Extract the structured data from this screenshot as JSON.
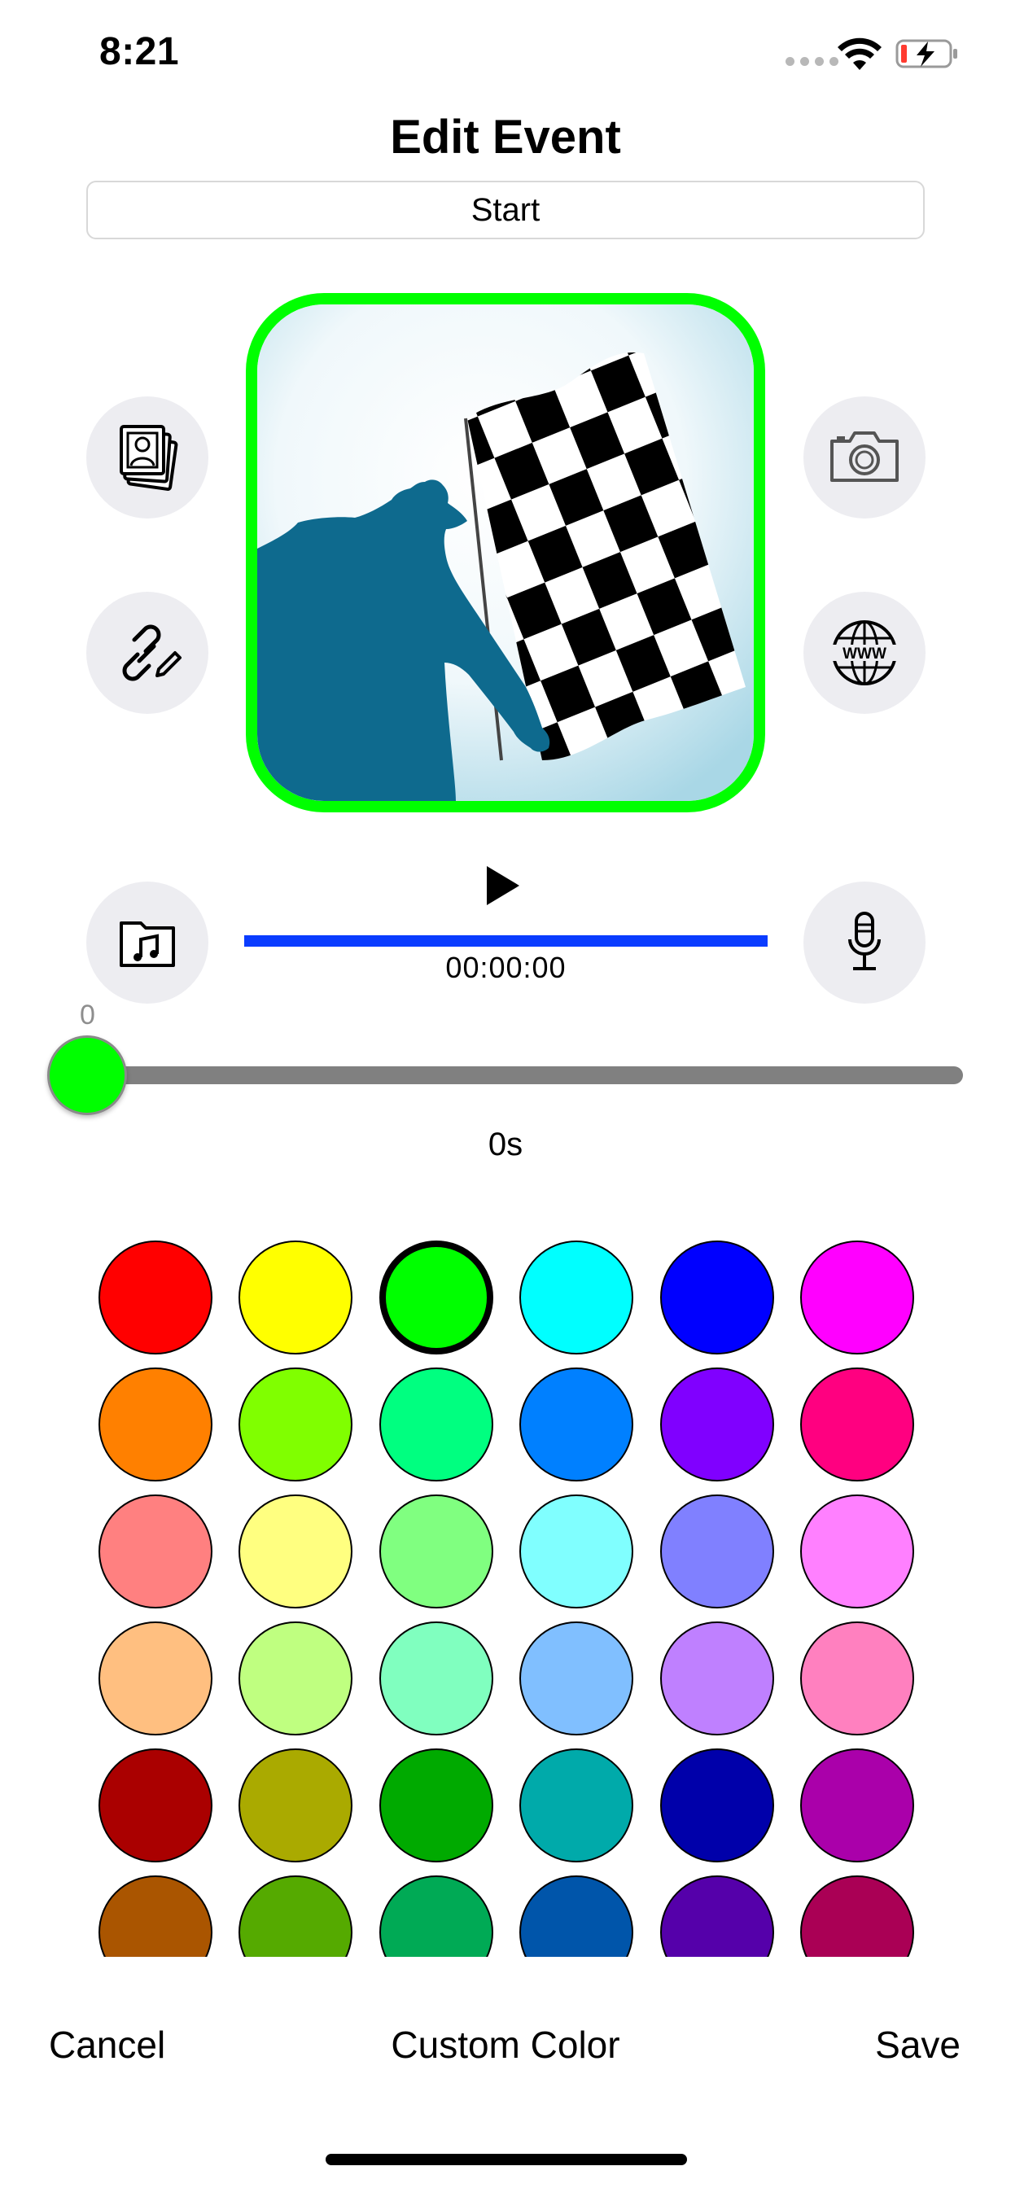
{
  "status_bar": {
    "time": "8:21",
    "battery_color": "#ff3b30"
  },
  "title": "Edit Event",
  "event_name": "Start",
  "media_buttons": {
    "left_top": "photo-library-icon",
    "left_bottom": "edit-link-icon",
    "right_top": "camera-icon",
    "right_bottom": "www-globe-icon",
    "music": "music-folder-icon",
    "record": "microphone-icon"
  },
  "audio": {
    "elapsed": "00:00:00",
    "progress": 0
  },
  "slider": {
    "min_label": "0",
    "value": 0,
    "value_label": "0s",
    "thumb_color": "#00ff00"
  },
  "palette": {
    "selected": "#00ff00",
    "colors": [
      [
        "#ff0000",
        "#ffff00",
        "#00ff00",
        "#00ffff",
        "#0000ff",
        "#ff00ff"
      ],
      [
        "#ff8000",
        "#80ff00",
        "#00ff80",
        "#0080ff",
        "#8000ff",
        "#ff0080"
      ],
      [
        "#ff8080",
        "#ffff80",
        "#80ff80",
        "#80ffff",
        "#8080ff",
        "#ff80ff"
      ],
      [
        "#ffbf80",
        "#bfff80",
        "#80ffbf",
        "#80bfff",
        "#bf80ff",
        "#ff80bf"
      ],
      [
        "#aa0000",
        "#aaaa00",
        "#00aa00",
        "#00aaaa",
        "#0000aa",
        "#aa00aa"
      ],
      [
        "#aa5500",
        "#55aa00",
        "#00aa55",
        "#0055aa",
        "#5500aa",
        "#aa0055"
      ]
    ]
  },
  "actions": {
    "cancel": "Cancel",
    "custom_color": "Custom Color",
    "save": "Save"
  }
}
